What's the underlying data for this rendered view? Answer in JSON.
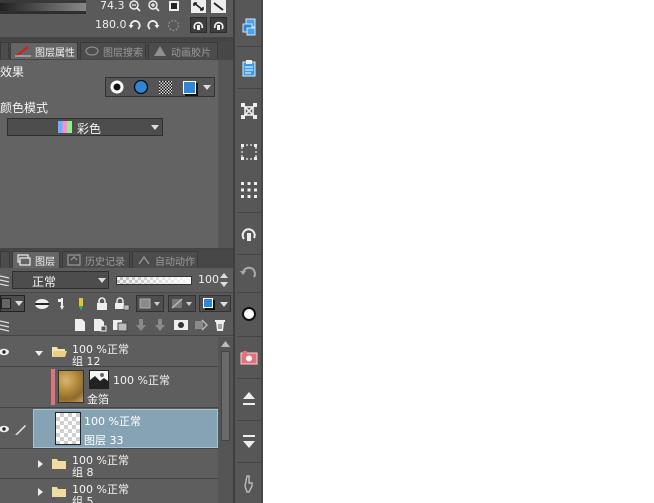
{
  "colors": {
    "panel": "#5e5e5e",
    "selected_row": "#86a3b6",
    "accent_blue": "#2f86d6",
    "clip_red": "#e0727b"
  },
  "nav": {
    "zoom_value": "74.3",
    "rotate_value": "180.0"
  },
  "property_panel": {
    "tabs": [
      {
        "label": "图层属性",
        "active": true
      },
      {
        "label": "图层搜索",
        "active": false
      },
      {
        "label": "动画胶片",
        "active": false
      }
    ],
    "effect_label": "效果",
    "color_mode_label": "颜色模式",
    "color_mode_value": "彩色"
  },
  "layer_panel": {
    "tabs": [
      {
        "label": "图层",
        "active": true
      },
      {
        "label": "历史记录",
        "active": false
      },
      {
        "label": "自动动作",
        "active": false
      }
    ],
    "blend_mode": "正常",
    "opacity_value": "100",
    "layers": [
      {
        "meta": "100 %正常",
        "name": "组 12"
      },
      {
        "meta": "100 %正常",
        "name": "金箔"
      },
      {
        "meta": "100 %正常",
        "name": "图层 33"
      },
      {
        "meta": "100 %正常",
        "name": "组 8"
      },
      {
        "meta": "100 %正常",
        "name": "组 5"
      }
    ]
  },
  "right_toolbar": {
    "icons": [
      "layers-stack-icon",
      "clipboard-icon",
      "transform-icon",
      "select-dots-icon",
      "grid-dots-icon",
      "rotate-hand-icon",
      "rotate-arrow-icon",
      "circle-icon",
      "camera-icon",
      "up-arrow-icon",
      "down-arrow-icon",
      "hand-icon"
    ]
  }
}
